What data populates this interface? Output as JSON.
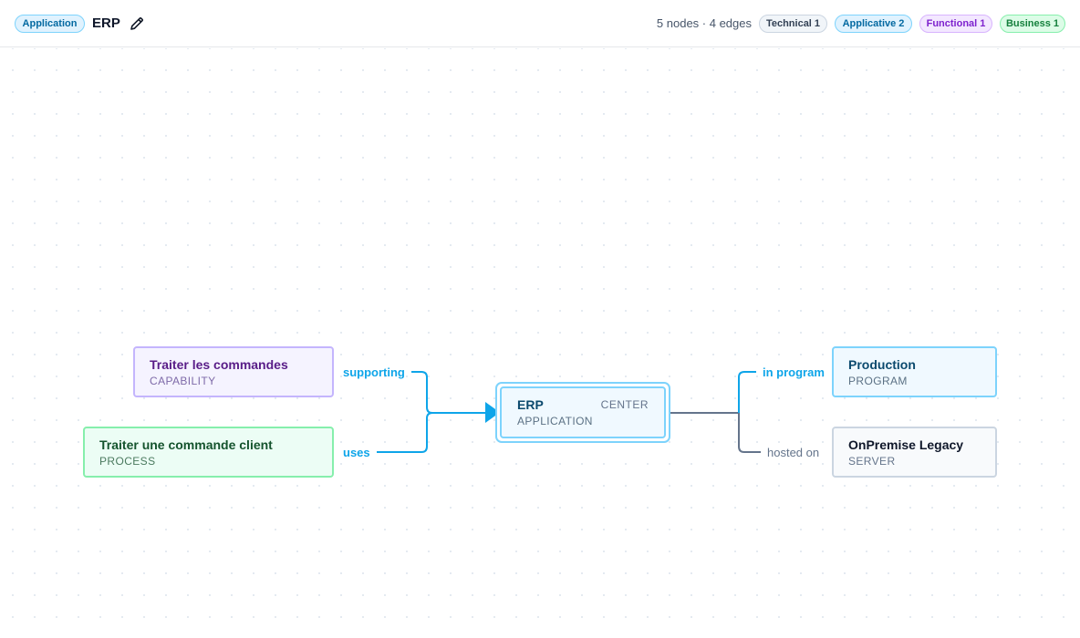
{
  "header": {
    "type_badge": "Application",
    "title": "ERP",
    "stats": "5 nodes · 4 edges",
    "filters": [
      {
        "label": "Technical 1"
      },
      {
        "label": "Applicative 2"
      },
      {
        "label": "Functional 1"
      },
      {
        "label": "Business 1"
      }
    ]
  },
  "graph": {
    "center": {
      "name": "ERP",
      "type": "APPLICATION",
      "tag": "CENTER"
    },
    "nodes": {
      "capability": {
        "name": "Traiter les commandes",
        "type": "CAPABILITY"
      },
      "process": {
        "name": "Traiter une commande client",
        "type": "PROCESS"
      },
      "program": {
        "name": "Production",
        "type": "PROGRAM"
      },
      "server": {
        "name": "OnPremise Legacy",
        "type": "SERVER"
      }
    },
    "edges": {
      "supporting": "supporting",
      "uses": "uses",
      "in_program": "in program",
      "hosted_on": "hosted on"
    }
  },
  "colors": {
    "applicative_edge": "#0ea5e9",
    "technical_edge": "#64748b",
    "center_border": "#7dd3fc"
  }
}
